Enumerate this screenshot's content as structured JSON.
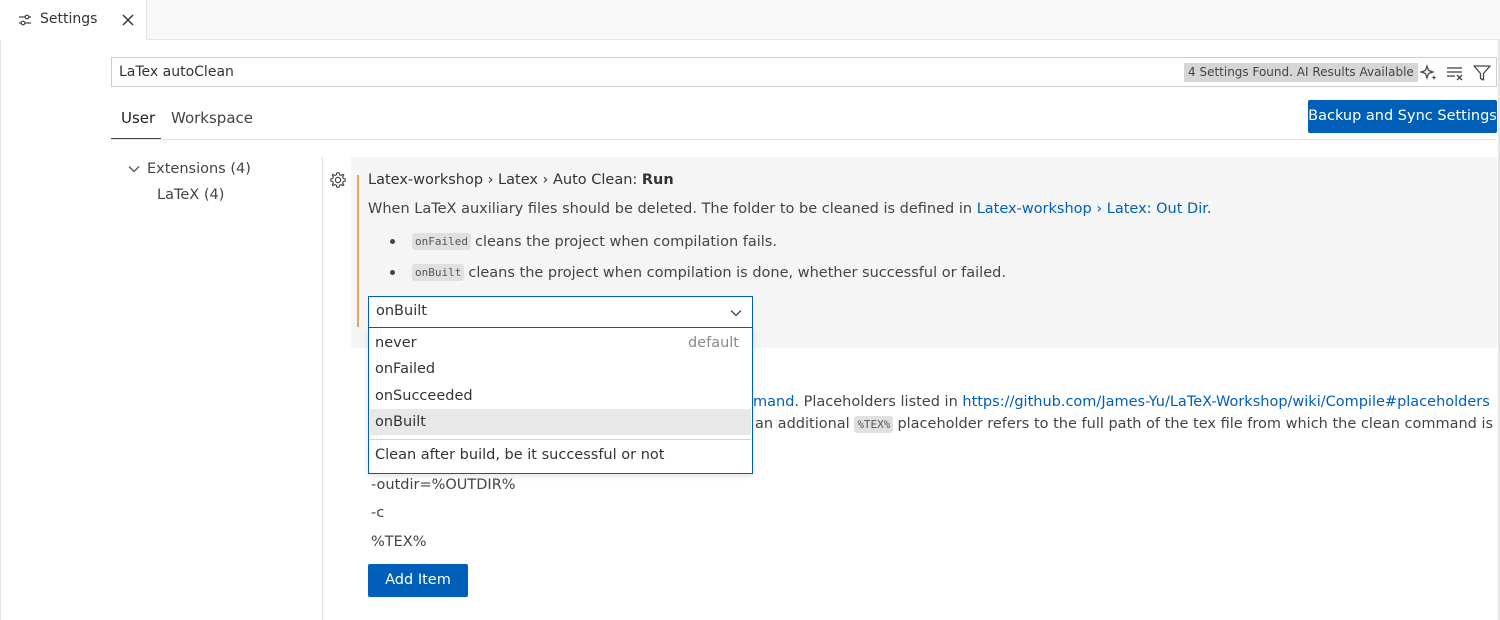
{
  "tab": {
    "label": "Settings",
    "icon": "settings-sliders-icon"
  },
  "search": {
    "value": "LaTex autoClean",
    "badge": "4 Settings Found. AI Results Available"
  },
  "scope_tabs": [
    {
      "label": "User"
    },
    {
      "label": "Workspace"
    }
  ],
  "sync_button": "Backup and Sync Settings",
  "toc": {
    "extensions": "Extensions (4)",
    "latex": "LaTeX (4)"
  },
  "setting": {
    "title_prefix": "Latex-workshop › Latex › Auto Clean: ",
    "title_name": "Run",
    "description": "When LaTeX auxiliary files should be deleted. The folder to be cleaned is defined in ",
    "description_link": "Latex-workshop › Latex: Out Dir",
    "description_end": ".",
    "bullets": [
      {
        "code": "onFailed",
        "text": "cleans the project when compilation fails."
      },
      {
        "code": "onBuilt",
        "text": "cleans the project when compilation is done, whether successful or failed."
      }
    ],
    "selected": "onBuilt",
    "options": [
      {
        "label": "never",
        "note": "default"
      },
      {
        "label": "onFailed",
        "note": ""
      },
      {
        "label": "onSucceeded",
        "note": ""
      },
      {
        "label": "onBuilt",
        "note": ""
      }
    ],
    "option_description": "Clean after build, be it successful or not"
  },
  "setting2": {
    "link_fragment": "mand",
    "text_after_link": ". Placeholders listed in ",
    "url": "https://github.com/James-Yu/LaTeX-Workshop/wiki/Compile#placeholders",
    "line2_prefix": "an additional ",
    "line2_code": "%TEX%",
    "line2_suffix": "placeholder refers to the full path of the tex file from which the clean command is",
    "args": [
      "-outdir=%OUTDIR%",
      "-c",
      "%TEX%"
    ],
    "add_button": "Add Item"
  },
  "colors": {
    "accent": "#005fb8",
    "modified_bar": "#e8a35a",
    "card_bg": "#f5f5f5"
  }
}
